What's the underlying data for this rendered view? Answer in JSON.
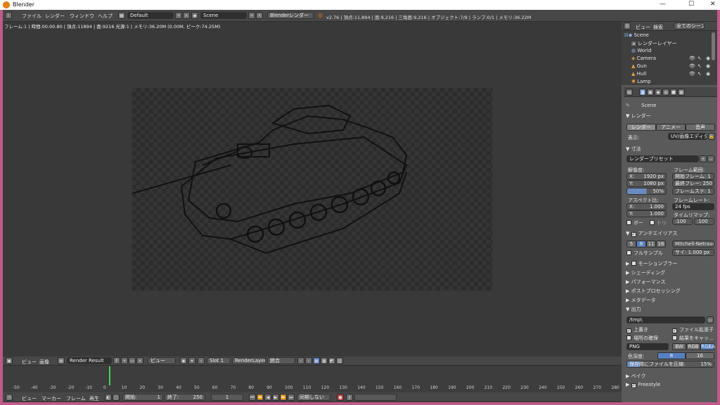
{
  "window": {
    "title": "Blender",
    "minimize": "—",
    "maximize": "☐",
    "close": "✕"
  },
  "topmenu": {
    "items": [
      "ファイル",
      "レンダー",
      "ウィンドウ",
      "ヘルプ"
    ],
    "layout": "Default",
    "scene": "Scene",
    "engine": "Blenderレンダー",
    "stats": "v2.76 | 頂点:11,894 | 面:9,216 | 三角面:9,216 | オブジェクト:7/9 | ランプ:0/1 | メモリ:36.22M"
  },
  "image_info": "フレーム:1 | 時間:00:00.80 | 頂点:11894 | 面:9216 光源:1 | メモリ:36.20M (0.00M, ピーク:74.25M)",
  "image_editor": {
    "view": "ビュー",
    "image": "画像",
    "image_name": "Render Result",
    "f_label": "F",
    "view_mode": "ビュー",
    "slot": "Slot 1",
    "layer": "RenderLayer",
    "pass": "統合"
  },
  "outliner": {
    "view": "ビュー",
    "search": "検索",
    "filter": "全てのシーン",
    "items": [
      {
        "name": "Scene"
      },
      {
        "name": "レンダーレイヤー"
      },
      {
        "name": "World"
      },
      {
        "name": "Camera"
      },
      {
        "name": "Gun"
      },
      {
        "name": "Hull"
      },
      {
        "name": "Lamp"
      }
    ]
  },
  "properties": {
    "scene": "Scene",
    "render_header": "レンダー",
    "render_btn": "レンダー",
    "anim_btn": "アニメー",
    "audio_btn": "音声",
    "display_label": "表示:",
    "display_value": "UV/画像エディター",
    "dimensions_header": "寸法",
    "preset": "レンダープリセット",
    "resolution_label": "解像度:",
    "res_x": "X:",
    "res_x_val": "1920 px",
    "res_y": "Y:",
    "res_y_val": "1080 px",
    "res_pct": "50%",
    "frame_range_label": "フレーム範囲:",
    "start_frame": "開始フレーム: 1",
    "end_frame": "最終フレー: 250",
    "frame_step": "フレームステ: 1",
    "aspect_label": "アスペクト比:",
    "asp_x": "X:",
    "asp_x_val": "1.000",
    "asp_y": "Y:",
    "asp_y_val": "1.000",
    "frame_rate_label": "フレームレート:",
    "fps": "24 fps",
    "time_remap": "タイムリマップ:",
    "remap_old": ":100",
    "remap_new": ":100",
    "border": "ボー",
    "crop": "トリ",
    "aa_header": "アンチエイリアス",
    "aa_samples": [
      "5",
      "8",
      "11",
      "16"
    ],
    "aa_filter": "Mitchell-Netravali",
    "full_sample": "フルサンプル",
    "filter_size": "サイ: 1.000 px",
    "sections": [
      "モーションブラー",
      "シェーディング",
      "パフォーマンス",
      "ポストプロセッシング",
      "メタデータ"
    ],
    "output_header": "出力",
    "output_path": "/tmp\\",
    "overwrite": "上書き",
    "file_ext": "ファイル拡張子",
    "placeholders": "場所の確保",
    "cache_result": "結果をキャッ…",
    "format": "PNG",
    "bw": "BW",
    "rgb": "RGB",
    "rgba": "RGBA",
    "color_depth_label": "色深度:",
    "depth8": "8",
    "depth16": "16",
    "compression": "保存時にファイルを圧縮:",
    "compression_val": "15%",
    "bake": "ベイク",
    "freestyle": "Freestyle"
  },
  "timeline": {
    "ticks": [
      "-50",
      "-40",
      "-30",
      "-20",
      "-10",
      "0",
      "10",
      "20",
      "30",
      "40",
      "50",
      "60",
      "70",
      "80",
      "90",
      "100",
      "110",
      "120",
      "130",
      "140",
      "150",
      "160",
      "170",
      "180",
      "190",
      "200",
      "210",
      "220",
      "230",
      "240",
      "250",
      "260",
      "270",
      "280"
    ],
    "view": "ビュー",
    "marker": "マーカー",
    "frame": "フレーム",
    "playback": "再生",
    "start": "開始:",
    "start_val": "1",
    "end": "終了:",
    "end_val": "250",
    "current": "1",
    "sync": "同期しない"
  }
}
